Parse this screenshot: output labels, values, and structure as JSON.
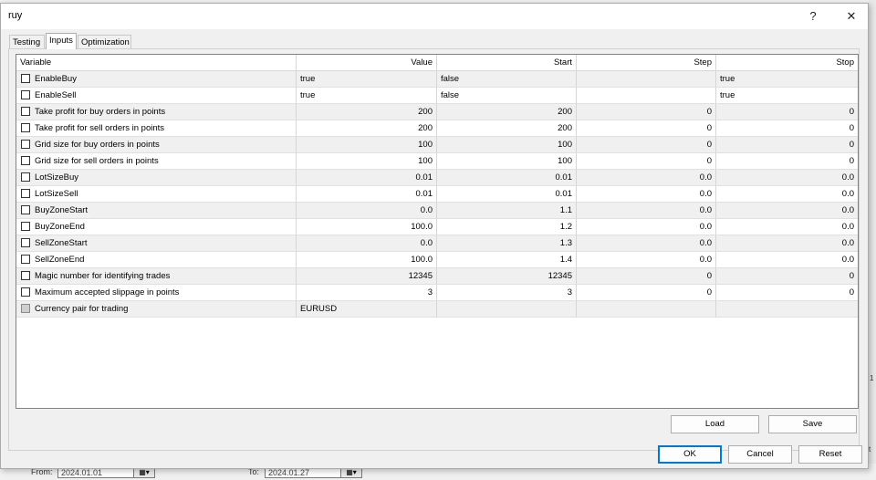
{
  "window": {
    "title": "ruy",
    "help_label": "?",
    "close_label": "✕"
  },
  "tabs": [
    {
      "label": "Testing",
      "active": false
    },
    {
      "label": "Inputs",
      "active": true
    },
    {
      "label": "Optimization",
      "active": false
    }
  ],
  "grid": {
    "columns": [
      "Variable",
      "Value",
      "Start",
      "Step",
      "Stop"
    ],
    "rows": [
      {
        "variable": "EnableBuy",
        "value": "true",
        "start": "false",
        "step": "",
        "stop": "true",
        "checked": false,
        "enabled": true
      },
      {
        "variable": "EnableSell",
        "value": "true",
        "start": "false",
        "step": "",
        "stop": "true",
        "checked": false,
        "enabled": true
      },
      {
        "variable": "Take profit for buy orders in points",
        "value": "200",
        "start": "200",
        "step": "0",
        "stop": "0",
        "checked": false,
        "enabled": true
      },
      {
        "variable": "Take profit for sell orders in points",
        "value": "200",
        "start": "200",
        "step": "0",
        "stop": "0",
        "checked": false,
        "enabled": true
      },
      {
        "variable": "Grid size for buy orders in points",
        "value": "100",
        "start": "100",
        "step": "0",
        "stop": "0",
        "checked": false,
        "enabled": true
      },
      {
        "variable": "Grid size for sell orders in points",
        "value": "100",
        "start": "100",
        "step": "0",
        "stop": "0",
        "checked": false,
        "enabled": true
      },
      {
        "variable": "LotSizeBuy",
        "value": "0.01",
        "start": "0.01",
        "step": "0.0",
        "stop": "0.0",
        "checked": false,
        "enabled": true
      },
      {
        "variable": "LotSizeSell",
        "value": "0.01",
        "start": "0.01",
        "step": "0.0",
        "stop": "0.0",
        "checked": false,
        "enabled": true
      },
      {
        "variable": "BuyZoneStart",
        "value": "0.0",
        "start": "1.1",
        "step": "0.0",
        "stop": "0.0",
        "checked": false,
        "enabled": true
      },
      {
        "variable": "BuyZoneEnd",
        "value": "100.0",
        "start": "1.2",
        "step": "0.0",
        "stop": "0.0",
        "checked": false,
        "enabled": true
      },
      {
        "variable": "SellZoneStart",
        "value": "0.0",
        "start": "1.3",
        "step": "0.0",
        "stop": "0.0",
        "checked": false,
        "enabled": true
      },
      {
        "variable": "SellZoneEnd",
        "value": "100.0",
        "start": "1.4",
        "step": "0.0",
        "stop": "0.0",
        "checked": false,
        "enabled": true
      },
      {
        "variable": "Magic number for identifying trades",
        "value": "12345",
        "start": "12345",
        "step": "0",
        "stop": "0",
        "checked": false,
        "enabled": true
      },
      {
        "variable": "Maximum accepted slippage in points",
        "value": "3",
        "start": "3",
        "step": "0",
        "stop": "0",
        "checked": false,
        "enabled": true
      },
      {
        "variable": "Currency pair for trading",
        "value": "EURUSD",
        "start": "",
        "step": "",
        "stop": "",
        "checked": false,
        "enabled": false
      }
    ]
  },
  "buttons": {
    "load": "Load",
    "save": "Save",
    "ok": "OK",
    "cancel": "Cancel",
    "reset": "Reset"
  },
  "background": {
    "from_label": "From:",
    "from_value": "2024.01.01",
    "to_label": "To:",
    "to_value": "2024.01.27",
    "calendar_icon": "calendar-icon",
    "edge_text_1": "1",
    "edge_text_2": "t"
  },
  "colors": {
    "row_gray": "#f0f0f0",
    "row_white": "#ffffff",
    "default_button_border": "#0078d7"
  }
}
